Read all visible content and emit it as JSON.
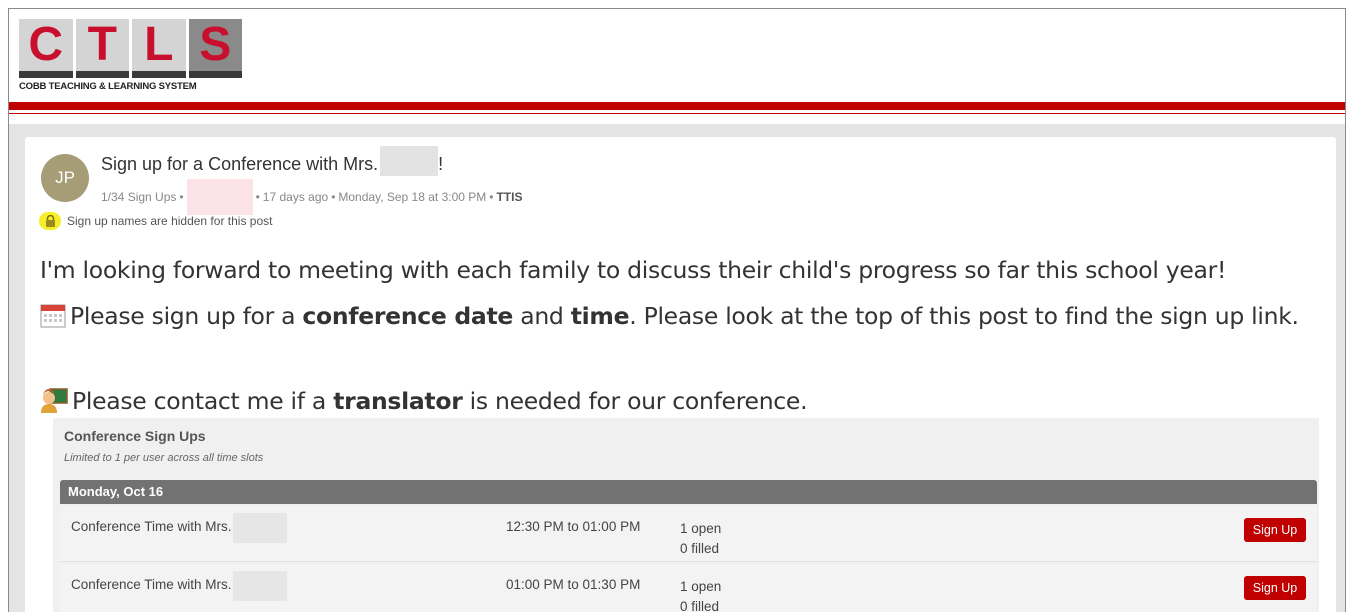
{
  "header": {
    "logo_letters": [
      "C",
      "T",
      "L",
      "S"
    ],
    "logo_text": "COBB TEACHING & LEARNING SYSTEM"
  },
  "post": {
    "avatar_initials": "JP",
    "title_prefix": "Sign up for a Conference with Mrs.",
    "title_suffix": "!",
    "signups": "1/34 Sign Ups",
    "bullet": "•",
    "time_ago": "17 days ago",
    "date": "Monday, Sep 18 at 3:00 PM",
    "source": "TTIS",
    "hidden_notice": "Sign up names are hidden for this post",
    "paragraph1": "I'm looking forward to meeting with each family to discuss their child's progress so far this school year!",
    "p2_a": "Please sign up for a ",
    "p2_b": "conference date",
    "p2_c": " and ",
    "p2_d": "time",
    "p2_e": ". Please look at the top of this post to find the sign up link.",
    "p3_a": "Please contact me if a ",
    "p3_b": "translator",
    "p3_c": " is needed for our conference."
  },
  "signup": {
    "title": "Conference Sign Ups",
    "subtitle": "Limited to 1 per user across all time slots",
    "date_header": "Monday, Oct 16",
    "slots": [
      {
        "name": "Conference Time with Mrs.",
        "time": "12:30 PM to 01:00 PM",
        "open": "1 open",
        "filled": "0 filled",
        "button": "Sign Up"
      },
      {
        "name": "Conference Time with Mrs.",
        "time": "01:00 PM to 01:30 PM",
        "open": "1 open",
        "filled": "0 filled",
        "button": "Sign Up"
      }
    ]
  },
  "colors": {
    "brand_red": "#c00000",
    "avatar": "#a69c76",
    "lock_highlight": "#f5ef2a"
  },
  "icons": [
    "lock-icon",
    "calendar-icon",
    "teacher-emoji-icon"
  ]
}
